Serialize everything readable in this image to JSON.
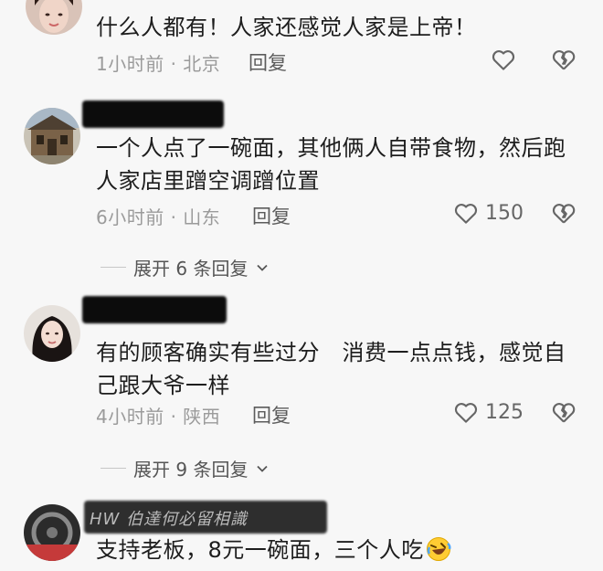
{
  "comments": [
    {
      "text": "什么人都有！人家还感觉人家是上帝！",
      "meta": "1小时前 · 北京",
      "reply_label": "回复",
      "like_count": ""
    },
    {
      "text": "一个人点了一碗面，其他俩人自带食物，然后跑人家店里蹭空调蹭位置",
      "meta": "6小时前 · 山东",
      "reply_label": "回复",
      "like_count": "150",
      "expand_label": "展开 6 条回复"
    },
    {
      "text": "有的顾客确实有些过分　消费一点点钱，感觉自己跟大爷一样",
      "meta": "4小时前 · 陕西",
      "reply_label": "回复",
      "like_count": "125",
      "expand_label": "展开 9 条回复"
    },
    {
      "username_partial": "HW 伯達何必留相識",
      "text": "支持老板，8元一碗面，三个人吃",
      "emoji": "rolling-on-floor-laughing-emoji"
    }
  ],
  "colors": {
    "background": "#f7f7f7",
    "text": "#1d1d1d",
    "meta": "#9b9b9b",
    "redaction": "#0c0c0c"
  },
  "icons": [
    "heart-icon",
    "broken-heart-icon",
    "chevron-down-icon"
  ]
}
